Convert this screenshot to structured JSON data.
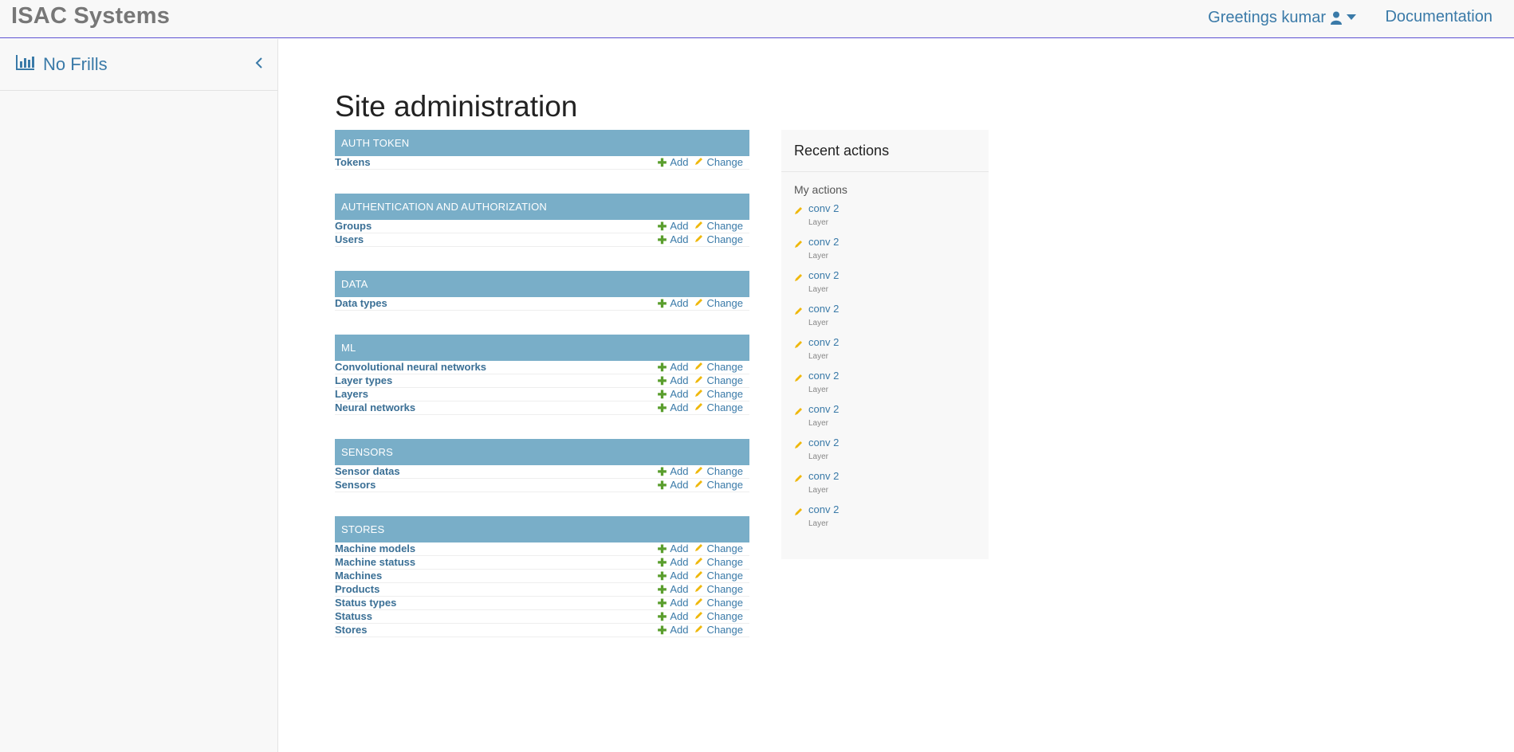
{
  "header": {
    "brand": "ISAC Systems",
    "greeting": "Greetings kumar",
    "documentation": "Documentation"
  },
  "sidebar": {
    "title": "No Frills"
  },
  "main": {
    "title": "Site administration",
    "modules": [
      {
        "caption": "AUTH TOKEN",
        "models": [
          "Tokens"
        ]
      },
      {
        "caption": "AUTHENTICATION AND AUTHORIZATION",
        "models": [
          "Groups",
          "Users"
        ]
      },
      {
        "caption": "DATA",
        "models": [
          "Data types"
        ]
      },
      {
        "caption": "ML",
        "models": [
          "Convolutional neural networks",
          "Layer types",
          "Layers",
          "Neural networks"
        ]
      },
      {
        "caption": "SENSORS",
        "models": [
          "Sensor datas",
          "Sensors"
        ]
      },
      {
        "caption": "STORES",
        "models": [
          "Machine models",
          "Machine statuss",
          "Machines",
          "Products",
          "Status types",
          "Statuss",
          "Stores"
        ]
      }
    ],
    "add_label": "Add",
    "change_label": "Change"
  },
  "recent": {
    "title": "Recent actions",
    "subtitle": "My actions",
    "items": [
      {
        "name": "conv 2",
        "type": "Layer"
      },
      {
        "name": "conv 2",
        "type": "Layer"
      },
      {
        "name": "conv 2",
        "type": "Layer"
      },
      {
        "name": "conv 2",
        "type": "Layer"
      },
      {
        "name": "conv 2",
        "type": "Layer"
      },
      {
        "name": "conv 2",
        "type": "Layer"
      },
      {
        "name": "conv 2",
        "type": "Layer"
      },
      {
        "name": "conv 2",
        "type": "Layer"
      },
      {
        "name": "conv 2",
        "type": "Layer"
      },
      {
        "name": "conv 2",
        "type": "Layer"
      }
    ]
  },
  "colors": {
    "module_header": "#79aec8",
    "link": "#3a7aa8",
    "add_icon": "#5a9e2d",
    "change_icon": "#efb80b"
  },
  "icons": {
    "user": "user-icon",
    "caret": "caret-down-icon",
    "chart": "bar-chart-icon",
    "collapse": "chevron-left-icon",
    "add": "plus-icon",
    "change": "pencil-icon"
  }
}
